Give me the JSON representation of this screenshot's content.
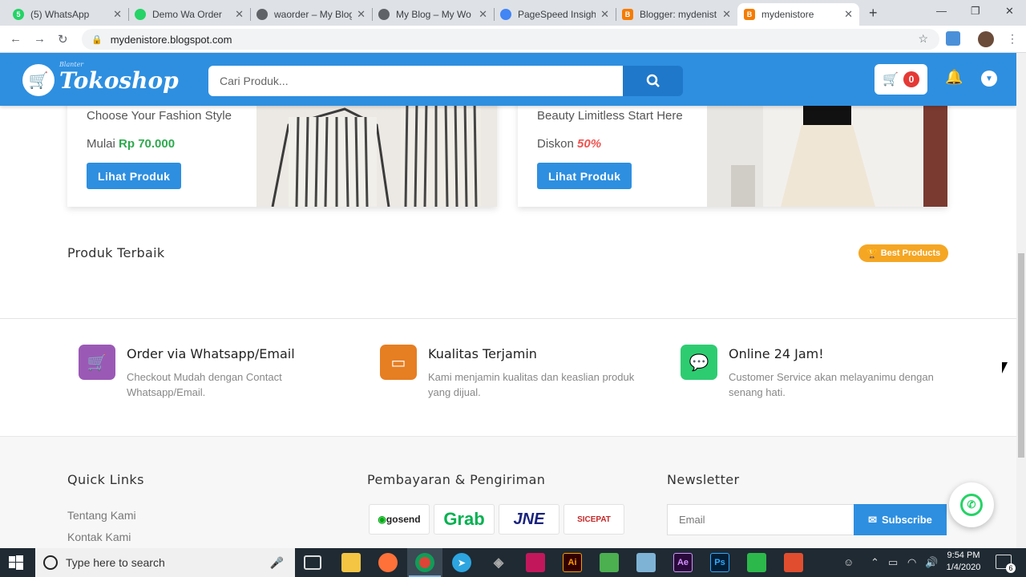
{
  "browser": {
    "tabs": [
      {
        "title": "(5) WhatsApp",
        "fav_color": "#25d366",
        "fav_char": "5"
      },
      {
        "title": "Demo Wa Order",
        "fav_color": "#25d366",
        "fav_char": ""
      },
      {
        "title": "waorder – My Blog",
        "fav_color": "#5f6368",
        "fav_char": ""
      },
      {
        "title": "My Blog – My Wo",
        "fav_color": "#5f6368",
        "fav_char": ""
      },
      {
        "title": "PageSpeed Insights",
        "fav_color": "#4285f4",
        "fav_char": ""
      },
      {
        "title": "Blogger: mydenist",
        "fav_color": "#f57c00",
        "fav_char": "B"
      },
      {
        "title": "mydenistore",
        "fav_color": "#f57c00",
        "fav_char": "B"
      }
    ],
    "url": "mydenistore.blogspot.com"
  },
  "site": {
    "logo_small": "Blanter",
    "logo_name": "Tokoshop",
    "search_placeholder": "Cari Produk...",
    "cart_count": "0",
    "banners": [
      {
        "subtitle": "Choose Your Fashion Style",
        "price_prefix": "Mulai",
        "price_value": "Rp 70.000",
        "button": "Lihat Produk"
      },
      {
        "subtitle": "Beauty Limitless Start Here",
        "price_prefix": "Diskon",
        "price_value": "50%",
        "button": "Lihat Produk"
      }
    ],
    "best_title": "Produk Terbaik",
    "best_badge": "Best Products",
    "features": [
      {
        "title": "Order via Whatsapp/Email",
        "desc": "Checkout Mudah dengan Contact Whatsapp/Email.",
        "color": "#9b59b6"
      },
      {
        "title": "Kualitas Terjamin",
        "desc": "Kami menjamin kualitas dan keaslian produk yang dijual.",
        "color": "#e67e22"
      },
      {
        "title": "Online 24 Jam!",
        "desc": "Customer Service akan melayanimu dengan senang hati.",
        "color": "#2ecc71"
      }
    ],
    "footer": {
      "quick_links_title": "Quick Links",
      "links": [
        "Tentang Kami",
        "Kontak Kami"
      ],
      "payment_title": "Pembayaran & Pengiriman",
      "payment_logos": [
        "gosend",
        "Grab",
        "JNE",
        "SICEPAT"
      ],
      "newsletter_title": "Newsletter",
      "email_placeholder": "Email",
      "subscribe_label": "Subscribe"
    }
  },
  "taskbar": {
    "search_placeholder": "Type here to search",
    "time": "9:54 PM",
    "date": "1/4/2020",
    "notifications": "6"
  }
}
